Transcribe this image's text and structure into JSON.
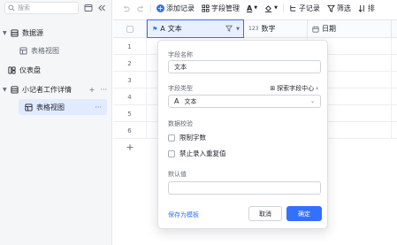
{
  "sidebar": {
    "search_placeholder": "搜索",
    "items": [
      {
        "label": "数据源"
      },
      {
        "label": "表格视图"
      },
      {
        "label": "仪表盘"
      },
      {
        "label": "小记者工作详情"
      },
      {
        "label": "表格视图"
      }
    ]
  },
  "toolbar": {
    "add_record": "添加记录",
    "field_manage": "字段管理",
    "sub_record": "子记录",
    "filter": "筛选",
    "sort": "排"
  },
  "grid": {
    "columns": [
      {
        "label": "文本"
      },
      {
        "label": "数字"
      },
      {
        "label": "日期"
      }
    ],
    "row_numbers": [
      "1",
      "2",
      "3",
      "4",
      "5",
      "6"
    ],
    "add_row": "+"
  },
  "popup": {
    "field_name_label": "字段名称",
    "field_name_value": "文本",
    "field_type_label": "字段类型",
    "explore_link": "探索字段中心",
    "field_type_value": "文本",
    "validation_label": "数据校验",
    "limit_chars": "限制字数",
    "no_duplicates": "禁止录入重复值",
    "default_label": "默认值",
    "default_value": "",
    "save_template": "保存为模板",
    "cancel": "取消",
    "confirm": "确定"
  },
  "colors": {
    "accent": "#3370ff",
    "sidebar_active": "#e1eaff",
    "header_selected": "#e8efff"
  }
}
